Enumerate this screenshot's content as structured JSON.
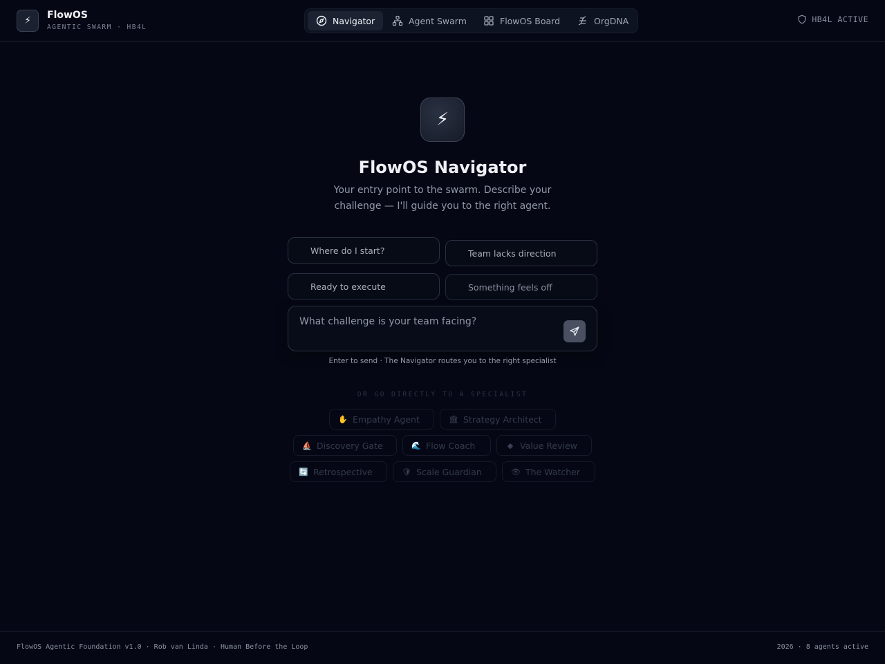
{
  "header": {
    "logo_glyph": "⚡",
    "brand_name": "FlowOS",
    "brand_sub": "AGENTIC SWARM · HB4L",
    "nav": [
      {
        "label": "Navigator",
        "icon": "compass-icon",
        "active": true
      },
      {
        "label": "Agent Swarm",
        "icon": "network-icon",
        "active": false
      },
      {
        "label": "FlowOS Board",
        "icon": "grid-icon",
        "active": false
      },
      {
        "label": "OrgDNA",
        "icon": "dna-icon",
        "active": false
      }
    ],
    "status_label": "HB4L ACTIVE",
    "status_icon": "shield-icon"
  },
  "hero": {
    "icon_glyph": "⚡",
    "title": "FlowOS Navigator",
    "subtitle": "Your entry point to the swarm. Describe your challenge — I'll guide you to the right agent."
  },
  "quick_prompts": [
    "Where do I start?",
    "Team lacks direction",
    "Ready to execute",
    "Something feels off"
  ],
  "input": {
    "placeholder": "What challenge is your team facing?",
    "value": "",
    "send_icon": "send-icon"
  },
  "hint": "Enter to send · The Navigator routes you to the right specialist",
  "specialists": {
    "title": "OR GO DIRECTLY TO A SPECIALIST",
    "items": [
      {
        "label": "Empathy Agent",
        "icon": "✋"
      },
      {
        "label": "Strategy Architect",
        "icon": "🏛"
      },
      {
        "label": "Discovery Gate",
        "icon": "⛵"
      },
      {
        "label": "Flow Coach",
        "icon": "🌊"
      },
      {
        "label": "Value Review",
        "icon": "◆"
      },
      {
        "label": "Retrospective",
        "icon": "🔄"
      },
      {
        "label": "Scale Guardian",
        "icon": "🛡"
      },
      {
        "label": "The Watcher",
        "icon": "👁"
      }
    ]
  },
  "footer": {
    "left": "FlowOS Agentic Foundation v1.0 · Rob van Linda · Human Before the Loop",
    "right": "2026 · 8 agents active"
  },
  "colors": {
    "background": "#050814",
    "surface": "#0e1322",
    "border": "#1e2433",
    "text": "#e6e8ef",
    "muted": "#9097a6"
  }
}
